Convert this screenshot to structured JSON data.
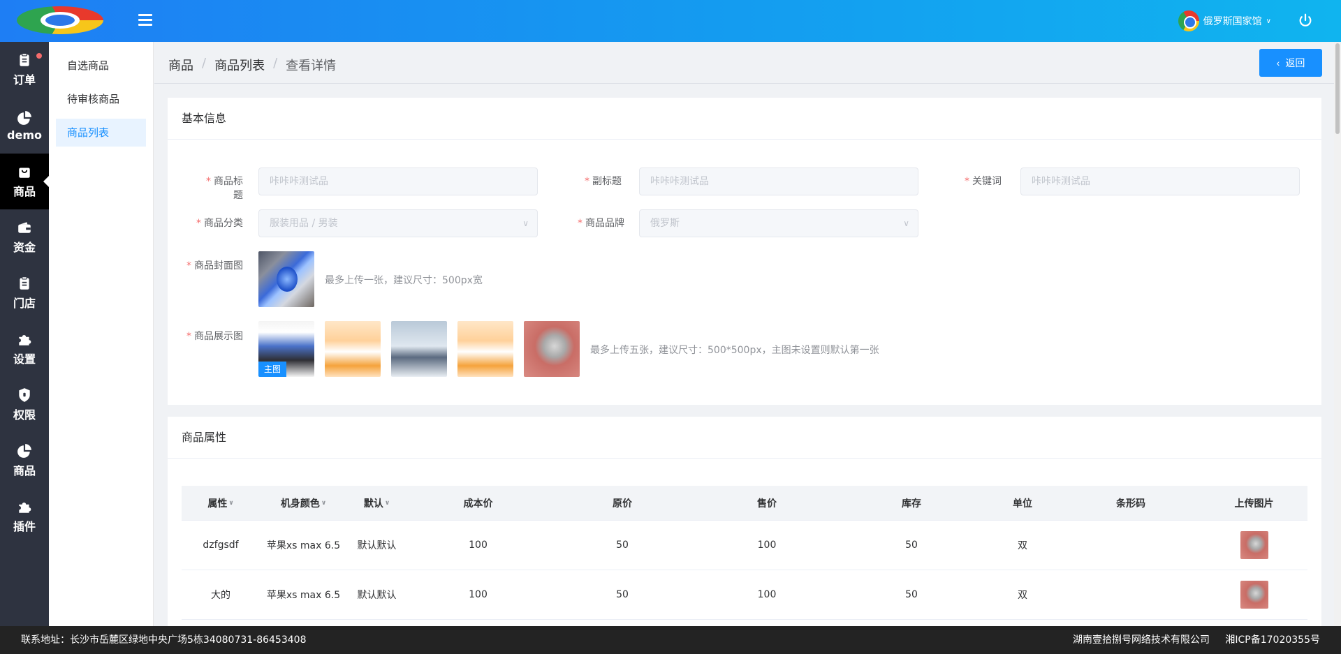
{
  "header": {
    "user_name": "俄罗斯国家馆"
  },
  "sidebar": {
    "items": [
      {
        "label": "订单",
        "icon": "clipboard-icon"
      },
      {
        "label": "demo",
        "icon": "pie-chart-icon"
      },
      {
        "label": "商品",
        "icon": "bag-icon"
      },
      {
        "label": "资金",
        "icon": "wallet-icon"
      },
      {
        "label": "门店",
        "icon": "clipboard-icon"
      },
      {
        "label": "设置",
        "icon": "puzzle-icon"
      },
      {
        "label": "权限",
        "icon": "shield-icon"
      },
      {
        "label": "商品",
        "icon": "pie-chart-icon"
      },
      {
        "label": "插件",
        "icon": "puzzle-icon"
      }
    ]
  },
  "submenu": {
    "items": [
      "自选商品",
      "待审核商品",
      "商品列表"
    ]
  },
  "breadcrumb": {
    "items": [
      "商品",
      "商品列表",
      "查看详情"
    ],
    "separator": "/"
  },
  "actions": {
    "back_label": "返回"
  },
  "basic_info": {
    "title": "基本信息",
    "fields": {
      "product_title": {
        "label": "商品标题",
        "placeholder": "咔咔咔测试品"
      },
      "subtitle": {
        "label": "副标题",
        "placeholder": "咔咔咔测试品"
      },
      "keywords": {
        "label": "关键词",
        "placeholder": "咔咔咔测试品"
      },
      "category": {
        "label": "商品分类",
        "placeholder": "服装用品 / 男装"
      },
      "brand": {
        "label": "商品品牌",
        "placeholder": "俄罗斯"
      },
      "cover_image": {
        "label": "商品封面图",
        "hint": "最多上传一张，建议尺寸：500px宽"
      },
      "display_images": {
        "label": "商品展示图",
        "hint": "最多上传五张，建议尺寸：500*500px，主图未设置则默认第一张",
        "main_badge": "主图"
      }
    }
  },
  "attributes": {
    "title": "商品属性",
    "columns": [
      "属性",
      "机身颜色",
      "默认",
      "成本价",
      "原价",
      "售价",
      "库存",
      "单位",
      "条形码",
      "上传图片"
    ],
    "rows": [
      {
        "attr": "dzfgsdf",
        "color": "苹果xs max 6.5",
        "default": "默认默认",
        "cost": "100",
        "original": "50",
        "price": "100",
        "stock": "50",
        "unit": "双",
        "barcode": ""
      },
      {
        "attr": "大的",
        "color": "苹果xs max 6.5",
        "default": "默认默认",
        "cost": "100",
        "original": "50",
        "price": "100",
        "stock": "50",
        "unit": "双",
        "barcode": ""
      }
    ]
  },
  "footer": {
    "address": "联系地址：长沙市岳麓区绿地中央广场5栋34080731-86453408",
    "company": "湖南壹拾捌号网络技术有限公司",
    "icp": "湘ICP备17020355号"
  },
  "colors": {
    "primary": "#1890ff",
    "sidebar_bg": "#2e3340",
    "required_star": "#f56c6c"
  }
}
